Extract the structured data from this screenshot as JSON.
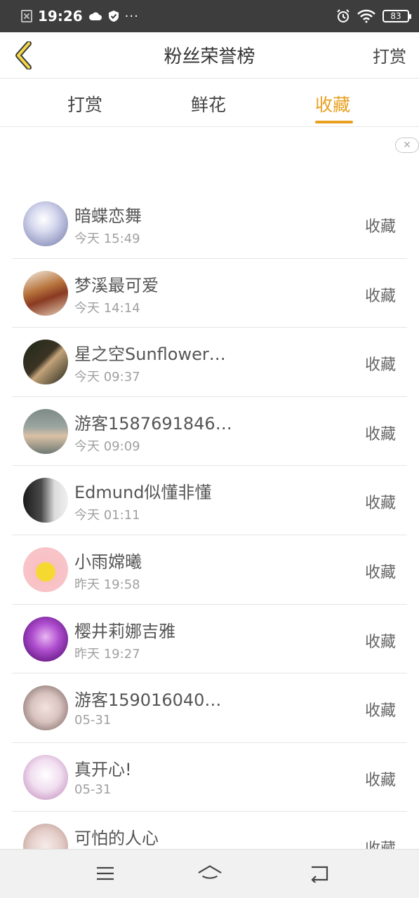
{
  "status_bar": {
    "time": "19:26",
    "dots": "···",
    "battery": "83"
  },
  "header": {
    "title": "粉丝荣誉榜",
    "action": "打赏"
  },
  "tabs": [
    {
      "label": "打赏",
      "active": false
    },
    {
      "label": "鲜花",
      "active": false
    },
    {
      "label": "收藏",
      "active": true
    }
  ],
  "accent_color": "#e8a020",
  "items": [
    {
      "name": "暗蝶恋舞",
      "time": "今天 15:49",
      "action": "收藏"
    },
    {
      "name": "梦溪最可爱",
      "time": "今天 14:14",
      "action": "收藏"
    },
    {
      "name": "星之空Sunflower…",
      "time": "今天 09:37",
      "action": "收藏"
    },
    {
      "name": "游客1587691846…",
      "time": "今天 09:09",
      "action": "收藏"
    },
    {
      "name": "Edmund似懂非懂",
      "time": "今天 01:11",
      "action": "收藏"
    },
    {
      "name": "小雨嫦曦",
      "time": "昨天 19:58",
      "action": "收藏"
    },
    {
      "name": "樱井莉娜吉雅",
      "time": "昨天 19:27",
      "action": "收藏"
    },
    {
      "name": "游客159016040…",
      "time": "05-31",
      "action": "收藏"
    },
    {
      "name": "真开心!",
      "time": "05-31",
      "action": "收藏"
    },
    {
      "name": "可怕的人心",
      "time": "",
      "action": "收藏"
    }
  ]
}
